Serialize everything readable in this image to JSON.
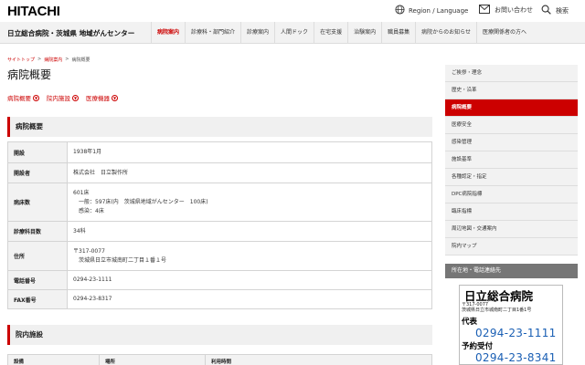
{
  "header": {
    "logo": "HITACHI",
    "region_label": "Region / Language",
    "contact_label": "お問い合わせ",
    "search_label": "検索"
  },
  "nav": {
    "site_name": "日立総合病院・茨城県 地域がんセンター",
    "items": [
      "病院案内",
      "診療科・部門紹介",
      "診療案内",
      "人間ドック",
      "在宅支援",
      "治験案内",
      "職員募集",
      "病院からのお知らせ",
      "医療関係者の方へ"
    ]
  },
  "breadcrumb": [
    "サイトトップ",
    ">",
    "病院案内",
    ">",
    "病院概要"
  ],
  "page_title": "病院概要",
  "anchors": [
    "病院概要",
    "院内施設",
    "医療機器"
  ],
  "overview": {
    "heading": "病院概要",
    "rows": [
      {
        "label": "開設",
        "lines": [
          "1938年1月"
        ]
      },
      {
        "label": "開設者",
        "lines": [
          "株式会社　日立製作所"
        ]
      },
      {
        "label": "病床数",
        "lines": [
          "601床",
          "　一般：597床(内　茨城県地域がんセンター　100床)",
          "　感染：4床"
        ]
      },
      {
        "label": "診療科目数",
        "lines": [
          "34科"
        ]
      },
      {
        "label": "住所",
        "lines": [
          "〒317-0077",
          "　茨城県日立市城南町二丁目１番１号"
        ]
      },
      {
        "label": "電話番号",
        "lines": [
          "0294-23-1111"
        ]
      },
      {
        "label": "FAX番号",
        "lines": [
          "0294-23-8317"
        ]
      }
    ]
  },
  "facilities": {
    "heading": "院内施設",
    "columns": [
      "設備",
      "場所",
      "利用時間"
    ]
  },
  "sidebar": {
    "items": [
      "ご挨拶・理念",
      "歴史・沿革",
      "病院概要",
      "医療安全",
      "感染管理",
      "施設基準",
      "各種認定・指定",
      "DPC病院指標",
      "臨床指標",
      "周辺地図・交通案内",
      "院内マップ"
    ],
    "active": "病院概要"
  },
  "contact": {
    "heading": "所在地・電話連絡先",
    "hospital": "日立総合病院",
    "zip": "〒317-0077",
    "address": "茨城県日立市城南町二丁目1番1号",
    "label_main": "代表",
    "tel_main": "0294-23-1111",
    "label_reserve": "予約受付",
    "tel_reserve": "0294-23-8341"
  },
  "colors": {
    "accent": "#cc0000",
    "link": "#1a5fb4"
  }
}
